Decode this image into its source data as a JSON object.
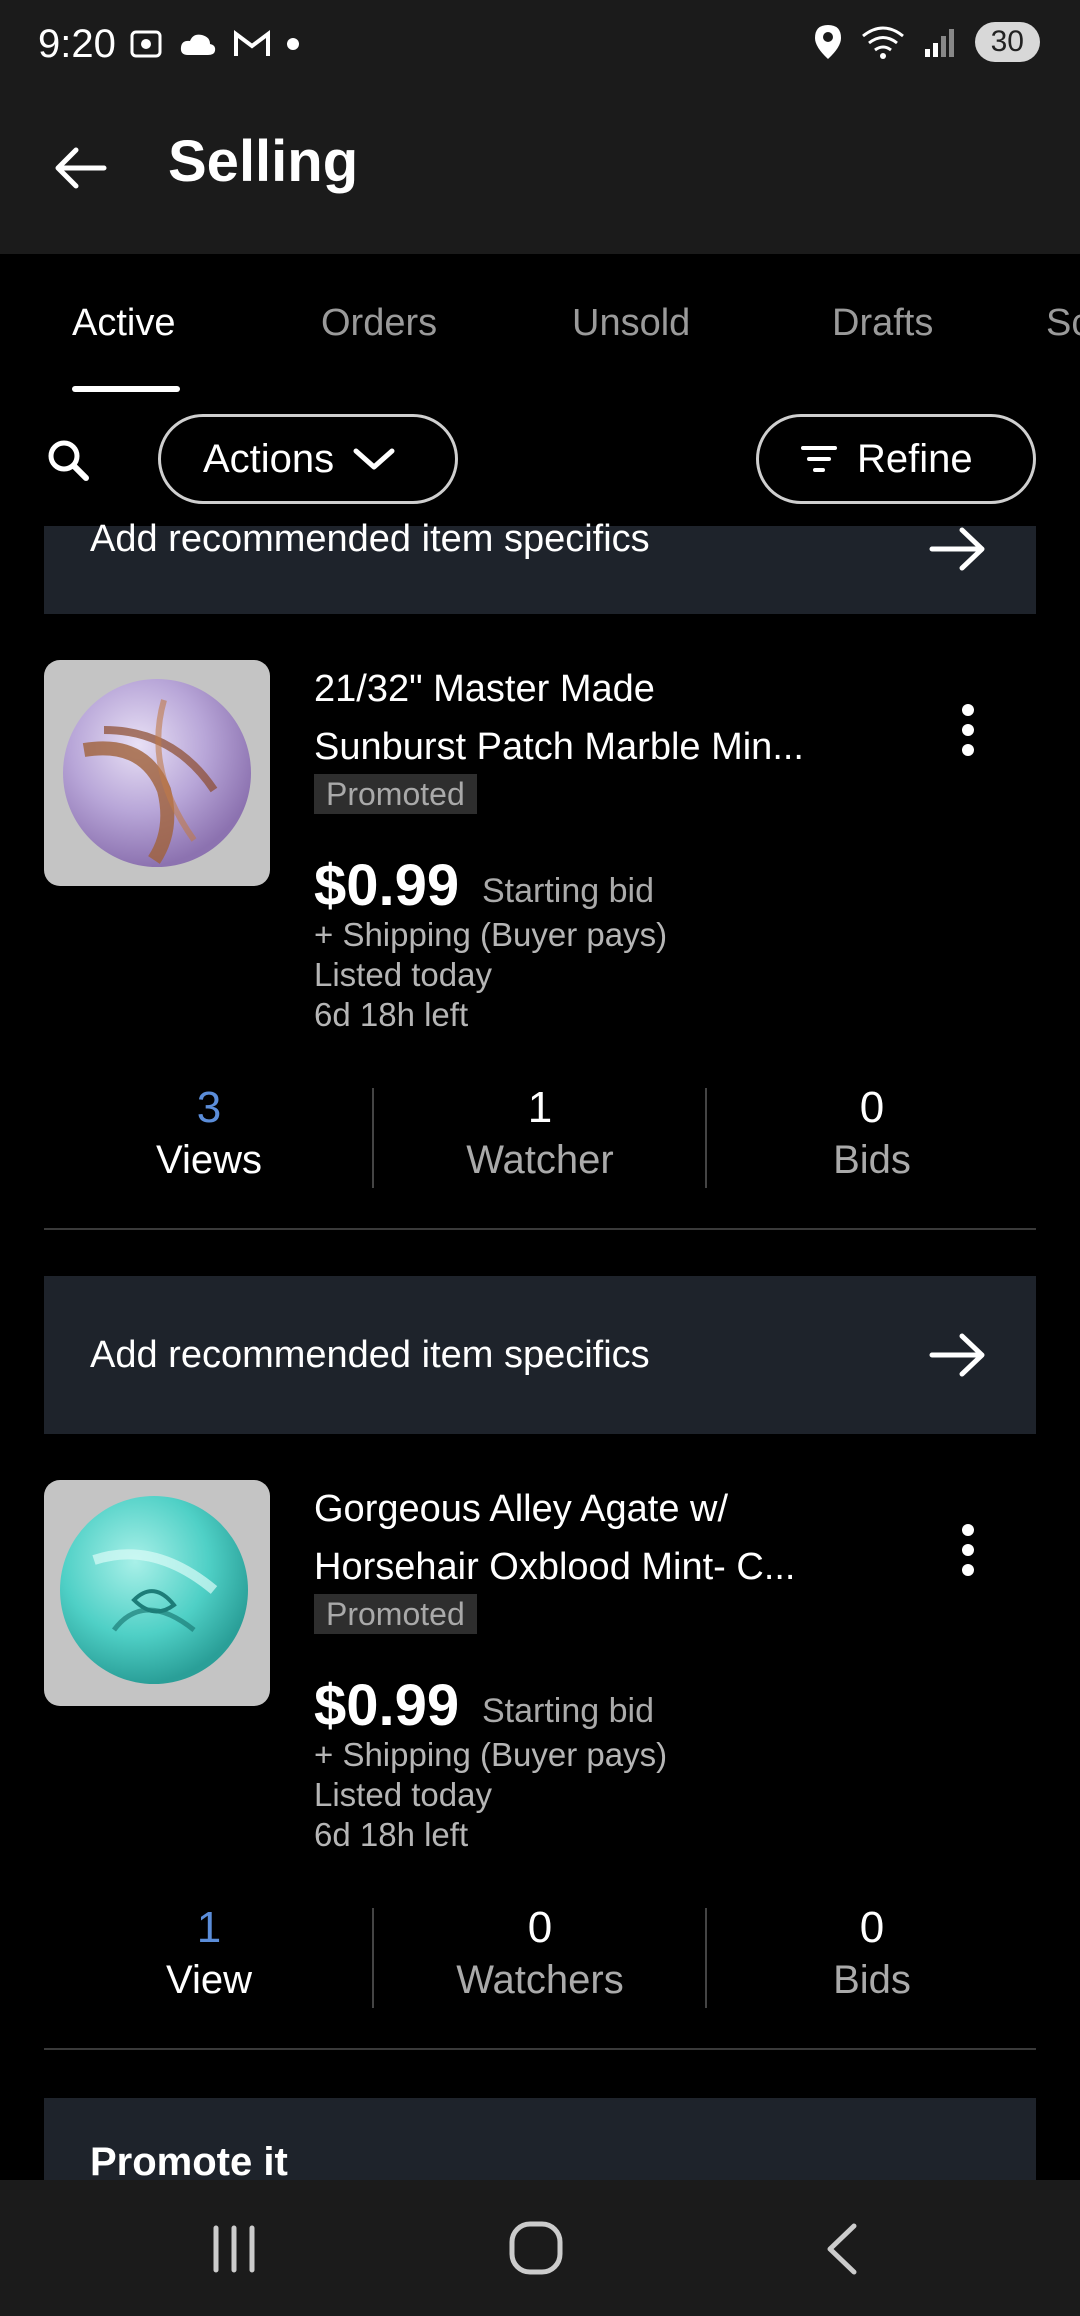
{
  "status_bar": {
    "time": "9:20",
    "battery": "30"
  },
  "header": {
    "title": "Selling"
  },
  "tabs": [
    {
      "label": "Active"
    },
    {
      "label": "Orders"
    },
    {
      "label": "Unsold"
    },
    {
      "label": "Drafts"
    },
    {
      "label": "Sc"
    }
  ],
  "toolbar": {
    "actions_label": "Actions",
    "refine_label": "Refine"
  },
  "banners": {
    "specifics_top": "Add recommended item specifics",
    "specifics": "Add recommended item specifics"
  },
  "listings": [
    {
      "title_line1": "21/32\" Master Made",
      "title_line2": "Sunburst Patch Marble Min...",
      "badge": "Promoted",
      "price": "$0.99",
      "price_label": "Starting bid",
      "shipping": "+ Shipping (Buyer pays)",
      "listed": "Listed today",
      "time_left": "6d 18h left",
      "stats": [
        {
          "num": "3",
          "label": "Views"
        },
        {
          "num": "1",
          "label": "Watcher"
        },
        {
          "num": "0",
          "label": "Bids"
        }
      ]
    },
    {
      "title_line1": "Gorgeous Alley Agate w/",
      "title_line2": "Horsehair Oxblood Mint- C...",
      "badge": "Promoted",
      "price": "$0.99",
      "price_label": "Starting bid",
      "shipping": "+ Shipping (Buyer pays)",
      "listed": "Listed today",
      "time_left": "6d 18h left",
      "stats": [
        {
          "num": "1",
          "label": "View"
        },
        {
          "num": "0",
          "label": "Watchers"
        },
        {
          "num": "0",
          "label": "Bids"
        }
      ]
    }
  ],
  "promote": {
    "label": "Promote it"
  },
  "colors": {
    "accent_blue": "#5b8dd9",
    "banner_bg": "#1e232b"
  },
  "icons": [
    "back-arrow-icon",
    "search-icon",
    "chevron-down-icon",
    "filter-icon",
    "arrow-right-icon",
    "kebab-menu-icon",
    "recents-icon",
    "home-icon",
    "nav-back-icon"
  ]
}
